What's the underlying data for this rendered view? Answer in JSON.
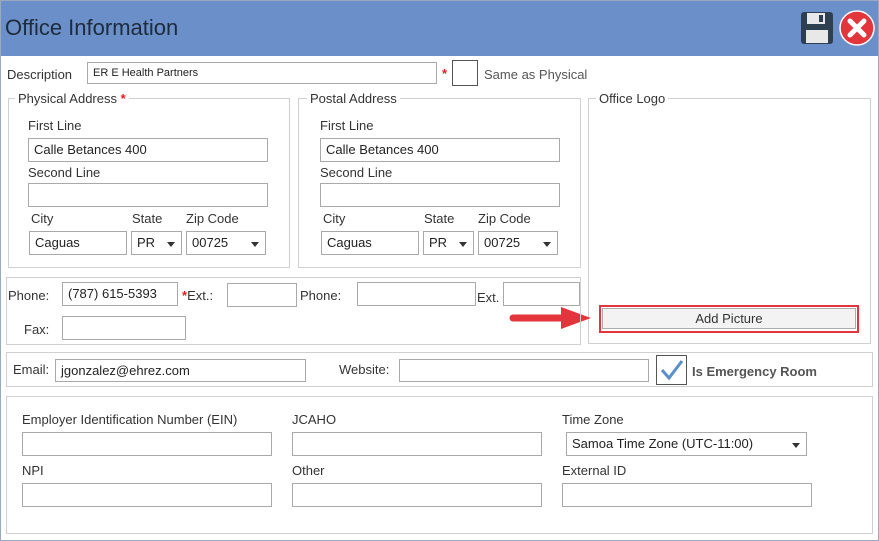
{
  "window": {
    "title": "Office Information"
  },
  "description": {
    "label": "Description",
    "value": "ER E Health Partners",
    "required": "*",
    "same_as_physical": "Same as Physical"
  },
  "physical": {
    "title": "Physical Address",
    "required": "*",
    "first_line_label": "First Line",
    "first_line": "Calle Betances 400",
    "second_line_label": "Second Line",
    "second_line": "",
    "city_label": "City",
    "city": "Caguas",
    "state_label": "State",
    "state": "PR",
    "zip_label": "Zip Code",
    "zip": "00725"
  },
  "postal": {
    "title": "Postal Address",
    "first_line_label": "First Line",
    "first_line": "Calle Betances 400",
    "second_line_label": "Second Line",
    "second_line": "",
    "city_label": "City",
    "city": "Caguas",
    "state_label": "State",
    "state": "PR",
    "zip_label": "Zip Code",
    "zip": "00725"
  },
  "logo": {
    "title": "Office Logo",
    "add_picture": "Add Picture"
  },
  "phones": {
    "phone_label": "Phone:",
    "phone": "(787) 615-5393",
    "ext_required": "*",
    "ext_label": "Ext.:",
    "ext": "",
    "phone2_label": "Phone:",
    "phone2": "",
    "ext2_label": "Ext.",
    "ext2": "",
    "fax_label": "Fax:",
    "fax": ""
  },
  "contact": {
    "email_label": "Email:",
    "email": "jgonzalez@ehrez.com",
    "website_label": "Website:",
    "website": "",
    "emergency_label": "Is Emergency Room",
    "emergency_checked": true
  },
  "ids": {
    "ein_label": "Employer Identification Number (EIN)",
    "ein": "",
    "jcaho_label": "JCAHO",
    "jcaho": "",
    "timezone_label": "Time Zone",
    "timezone": "Samoa Time Zone (UTC-11:00)",
    "npi_label": "NPI",
    "npi": "",
    "other_label": "Other",
    "other": "",
    "external_label": "External ID",
    "external": ""
  },
  "colors": {
    "titlebar": "#6a8fc9",
    "accent_red": "#e3353c",
    "required": "#e02020"
  }
}
